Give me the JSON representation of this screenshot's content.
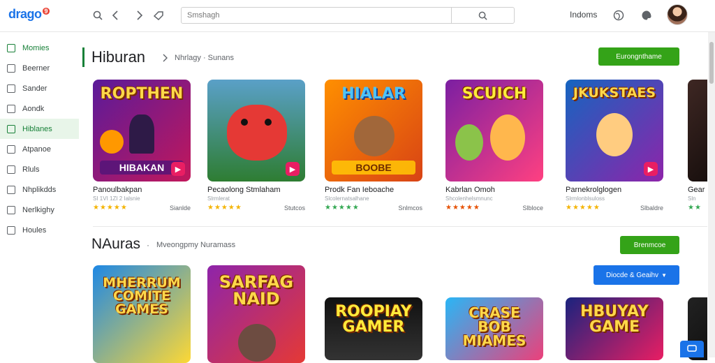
{
  "header": {
    "logo": "drago",
    "logo_badge": "9",
    "search_placeholder": "Smshagh",
    "language": "Indoms"
  },
  "sidebar": {
    "items": [
      {
        "label": "Momies",
        "active": false
      },
      {
        "label": "Beerner",
        "active": false
      },
      {
        "label": "Sander",
        "active": false
      },
      {
        "label": "Aondk",
        "active": false
      },
      {
        "label": "Hiblanes",
        "active": true
      },
      {
        "label": "Atpanoe",
        "active": false
      },
      {
        "label": "Rluls",
        "active": false
      },
      {
        "label": "Nhplikdds",
        "active": false
      },
      {
        "label": "Nerlkighy",
        "active": false
      },
      {
        "label": "Houles",
        "active": false
      }
    ]
  },
  "section1": {
    "title": "Hiburan",
    "subtitle": "Nhrlagy · Sunans",
    "button": "Eurongnthame",
    "cards": [
      {
        "name": "Panoulbakpan",
        "meta": "SI 1VI 1ZI 2 Ialsnie",
        "stars": "★★★★★",
        "price": "Sianlde",
        "thumb_title": "ROPTHEN",
        "thumb_sub": "HIBAKAN",
        "bg": "linear-gradient(135deg,#5a1a9a,#c2185b)"
      },
      {
        "name": "Pecaolong Stmlaham",
        "meta": "Slrmlerat",
        "stars": "★★★★★",
        "price": "Stutcos",
        "thumb_title": "",
        "thumb_sub": "",
        "bg": "linear-gradient(180deg,#5aa0c8,#2e7d32)"
      },
      {
        "name": "Prodk Fan Ieboache",
        "meta": "Slcolernatsalhane",
        "stars": "★★★★★",
        "price": "Snlmcos",
        "thumb_title": "HIALAR",
        "thumb_sub": "BOOBE",
        "bg": "linear-gradient(135deg,#ff8f00,#d84315)"
      },
      {
        "name": "Kabrlan Omoh",
        "meta": "Shcolenhelsmnunc",
        "stars": "★★★★★",
        "price": "Slbloce",
        "thumb_title": "SCUICH",
        "thumb_sub": "",
        "bg": "linear-gradient(135deg,#7b1fa2,#ff4081)"
      },
      {
        "name": "Parnekrolglogen",
        "meta": "Slrmlonblsuloss",
        "stars": "★★★★★",
        "price": "Slbaldre",
        "thumb_title": "JKUKSTAES",
        "thumb_sub": "",
        "bg": "linear-gradient(135deg,#1565c0,#8e24aa)"
      },
      {
        "name": "Gear",
        "meta": "Sln",
        "stars": "★★",
        "price": "",
        "thumb_title": "",
        "thumb_sub": "",
        "bg": "linear-gradient(135deg,#3e2723,#000)"
      }
    ]
  },
  "section2": {
    "title": "NAuras",
    "subtitle": "Mveongpmy Nuramass",
    "button": "Brenmcoe",
    "button2": "Diocde & Geaihv",
    "cards": [
      {
        "thumb_title": "MHERRUM COMITE GAMES",
        "bg": "linear-gradient(135deg,#1e88e5,#fdd835)"
      },
      {
        "thumb_title": "SARFAG NAID",
        "bg": "linear-gradient(135deg,#8e24aa,#e53935)"
      },
      {
        "thumb_title": "ROOPIAY GAMER",
        "bg": "linear-gradient(180deg,#111,#333)"
      },
      {
        "thumb_title": "CRASE BOB MIAMES",
        "bg": "linear-gradient(135deg,#29b6f6,#ec407a)"
      },
      {
        "thumb_title": "HBUYAY GAME",
        "bg": "linear-gradient(135deg,#1a237e,#e91e63)"
      },
      {
        "thumb_title": "",
        "bg": "linear-gradient(135deg,#222,#000)"
      }
    ]
  }
}
